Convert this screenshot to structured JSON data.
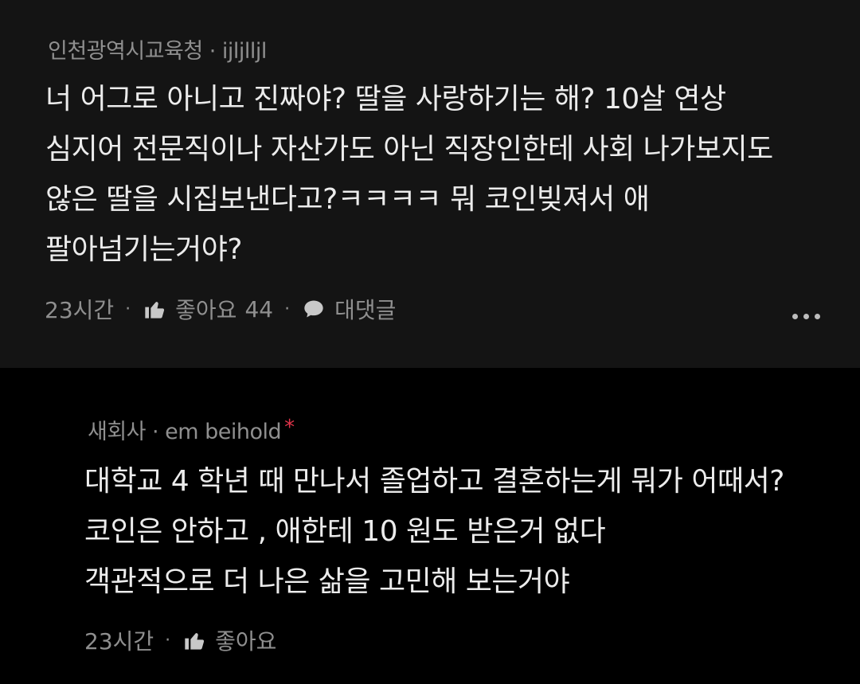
{
  "comments": [
    {
      "author_org": "인천광역시교육청",
      "author_name": "ijljlljl",
      "body_lines": [
        "너 어그로 아니고 진짜야? 딸을 사랑하기는 해? 10살 연상",
        "심지어 전문직이나 자산가도 아닌 직장인한테 사회 나가보지도",
        "않은 딸을 시집보낸다고?ㅋㅋㅋㅋ 뭐 코인빚져서 애",
        "팔아넘기는거야?"
      ],
      "time": "23시간",
      "like_label": "좋아요",
      "like_count": "44",
      "reply_label": "대댓글",
      "more_icon": "more-horizontal-icon"
    },
    {
      "author_org": "새회사",
      "author_name": "em beihold",
      "author_marker": "*",
      "body_lines": [
        "대학교 4 학년 때 만나서 졸업하고 결혼하는게 뭐가 어때서?",
        "코인은 안하고 , 애한테 10 원도 받은거 없다",
        "객관적으로 더 나은 삶을 고민해 보는거야"
      ],
      "time": "23시간",
      "like_label": "좋아요"
    }
  ],
  "colors": {
    "background": "#000000",
    "comment_bg": "#141414",
    "text": "#ececec",
    "meta": "#8f8f8f",
    "marker": "#e0344a"
  }
}
